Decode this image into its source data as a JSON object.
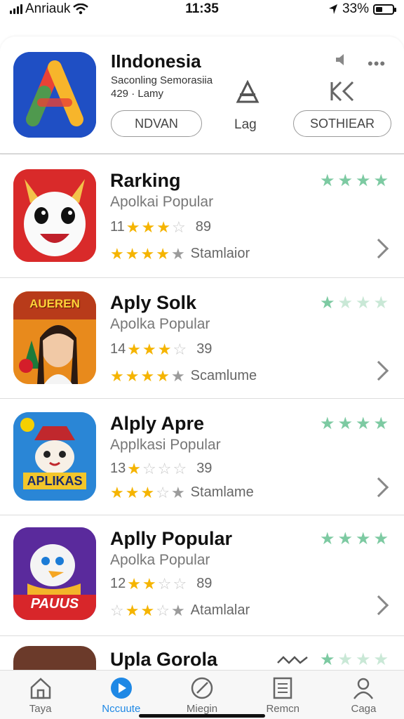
{
  "status": {
    "carrier": "Anriauk",
    "time": "11:35",
    "battery": "33%"
  },
  "featured": {
    "title": "IIndonesia",
    "subtitle": "Saconling Semorasiia",
    "meta": "429 · Lamy",
    "button_left": "NDVAN",
    "lag_label": "Lag",
    "button_right": "SOTHIEAR"
  },
  "apps": [
    {
      "name": "Rarking",
      "category": "Apolkai Popular",
      "rank": "11",
      "score": "89",
      "rating_gold": 3,
      "rank_stars": 4,
      "tag_stars": 4,
      "tag": "Stamlaior",
      "green_stars": 4,
      "icon": "ghost-mascot"
    },
    {
      "name": "Aply Solk",
      "category": "Apolka Popular",
      "rank": "14",
      "score": "39",
      "rating_gold": 3,
      "rank_stars": 4,
      "tag_stars": 4,
      "tag": "Scamlume",
      "green_stars": 1,
      "icon_text": "AUEREN",
      "icon": "portrait-game"
    },
    {
      "name": "Alply Apre",
      "category": "Applkasi Popular",
      "rank": "13",
      "score": "39",
      "rating_gold": 1,
      "rank_stars": 4,
      "tag_stars": 3,
      "tag": "Stamlame",
      "green_stars": 4,
      "icon_text": "APLIKAS",
      "icon": "fox-game"
    },
    {
      "name": "Aplly Popular",
      "category": "Apolka Popular",
      "rank": "12",
      "score": "89",
      "rating_gold": 2,
      "rank_stars": 4,
      "tag_stars": 3,
      "tag": "Atamlalar",
      "green_stars": 4,
      "icon_text": "PAUUS",
      "icon": "bird-game"
    },
    {
      "name": "Upla Gorola",
      "green_stars": 1,
      "icon": "partial-game"
    }
  ],
  "tabs": [
    {
      "label": "Taya",
      "icon": "home-icon"
    },
    {
      "label": "Nccuute",
      "icon": "play-icon"
    },
    {
      "label": "Miegin",
      "icon": "compass-icon"
    },
    {
      "label": "Remcn",
      "icon": "list-icon"
    },
    {
      "label": "Caga",
      "icon": "person-icon"
    }
  ],
  "colors": {
    "accent": "#1e88e5",
    "gold_star": "#f5b400",
    "green_star": "#7dcaa2"
  }
}
